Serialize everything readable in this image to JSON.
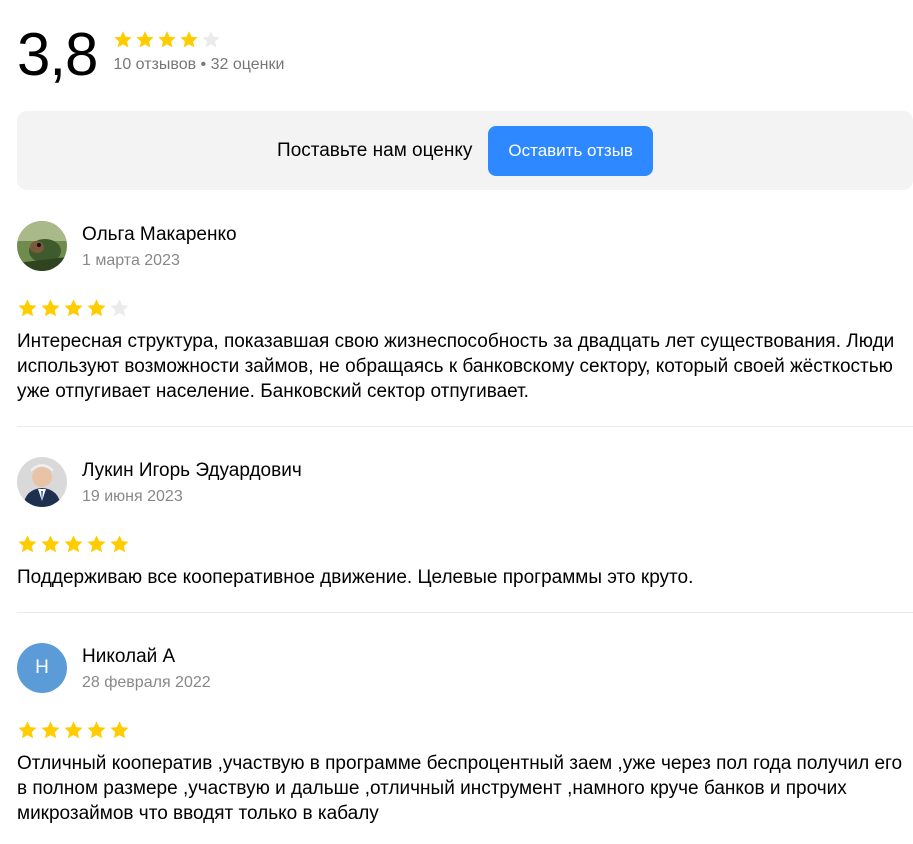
{
  "summary": {
    "rating": "3,8",
    "stars_filled": 4,
    "stars_total": 5,
    "counts": "10 отзывов • 32 оценки"
  },
  "cta": {
    "text": "Поставьте нам оценку",
    "button_label": "Оставить отзыв"
  },
  "reviews": [
    {
      "author": "Ольга Макаренко",
      "date": "1 марта 2023",
      "rating": 4,
      "text": "Интересная структура, показавшая свою жизнеспособность за двадцать лет существования. Люди используют возможности займов, не обращаясь к банковскому сектору, который своей жёсткостью уже отпугивает население. Банковский сектор отпугивает."
    },
    {
      "author": "Лукин Игорь Эдуардович",
      "date": "19 июня 2023",
      "rating": 5,
      "text": "Поддерживаю все кооперативное движение. Целевые программы это круто."
    },
    {
      "author": "Николай А",
      "avatar_letter": "Н",
      "date": "28 февраля 2022",
      "rating": 5,
      "text": "Отличный кооператив ,участвую в программе беспроцентный заем ,уже через пол года получил его в полном размере ,участвую и дальше ,отличный инструмент ,намного круче банков и прочих микрозаймов что вводят только в кабалу"
    }
  ],
  "colors": {
    "star_filled": "#fc0",
    "star_empty": "#ebebeb",
    "button": "#2e88ff",
    "cta_bg": "#f3f3f3"
  }
}
